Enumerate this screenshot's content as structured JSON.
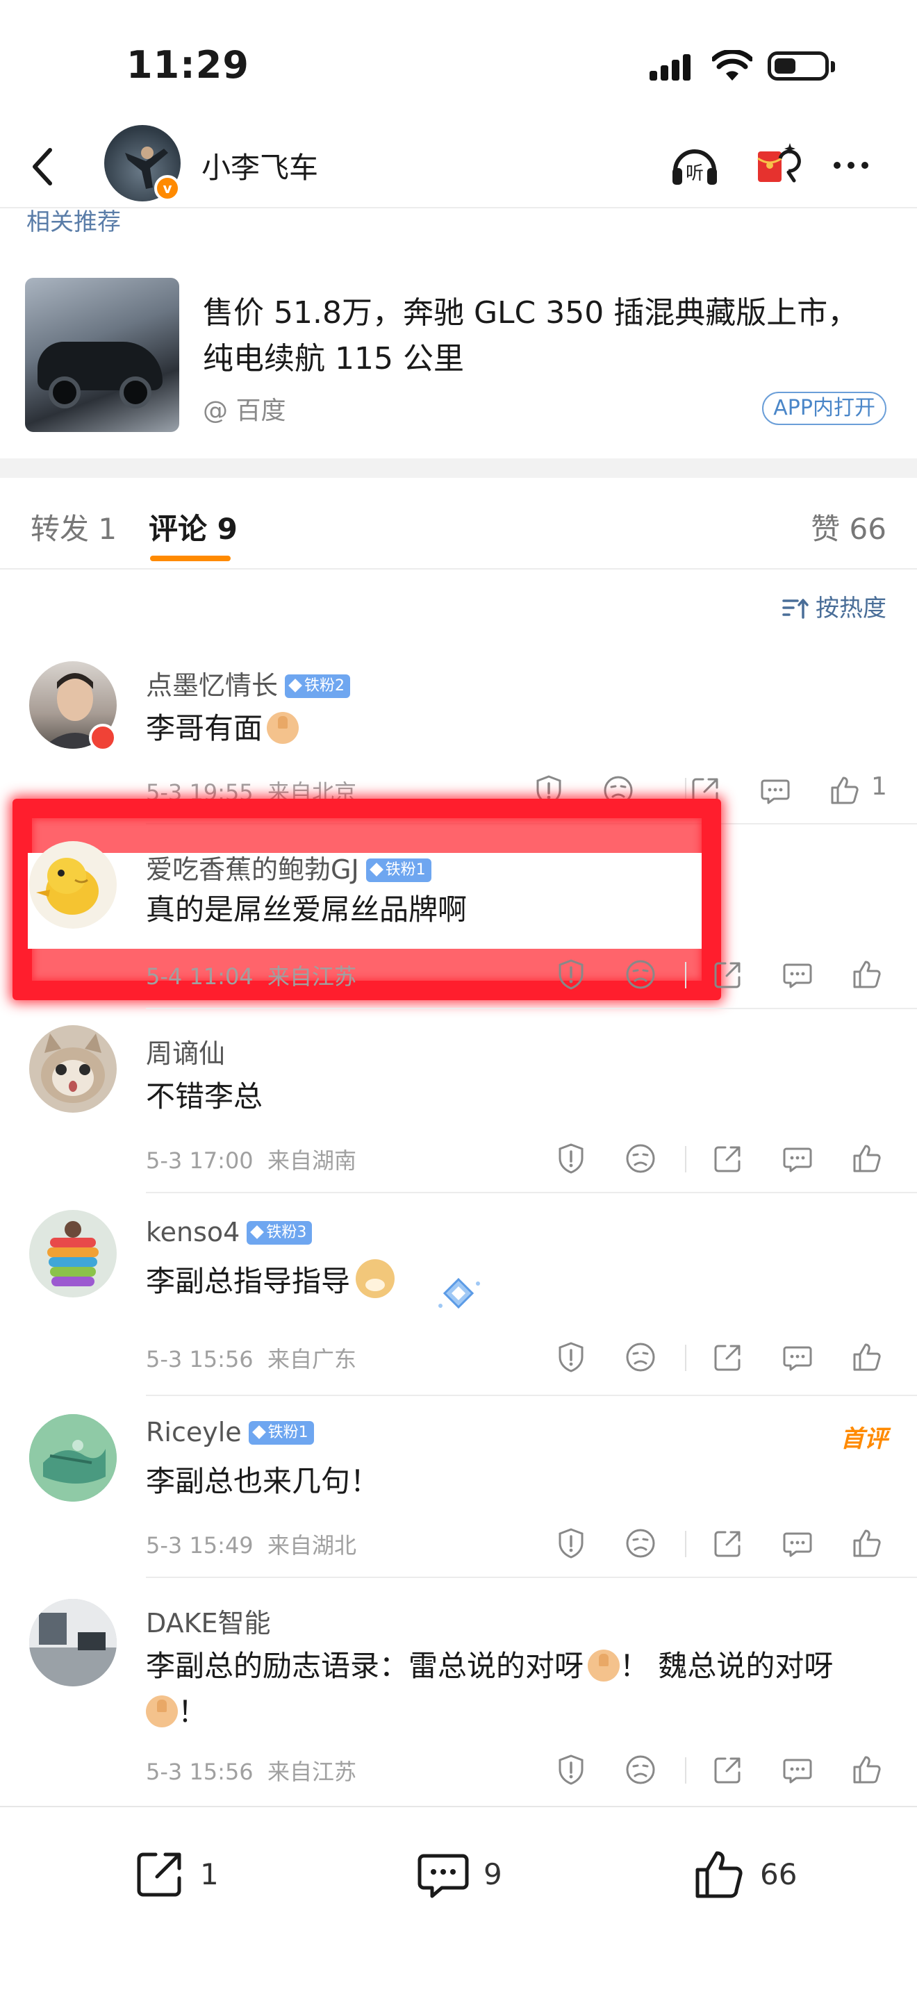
{
  "status_bar": {
    "time": "11:29"
  },
  "nav": {
    "username": "小李飞车",
    "verified_badge": "v",
    "icons": [
      "back-icon",
      "listen-icon",
      "red-envelope-icon",
      "more-icon"
    ],
    "listen_label": "听"
  },
  "related": {
    "label": "相关推荐"
  },
  "news": {
    "title": "售价 51.8万，奔驰 GLC 350 插混典藏版上市，纯电续航 115 公里",
    "source": "@ 百度",
    "open_button": "APP内打开"
  },
  "tabs": {
    "repost": "转发 1",
    "comments": "评论 9",
    "likes": "赞 66"
  },
  "sort": {
    "label": "按热度"
  },
  "comments": [
    {
      "name": "点墨忆情长",
      "badge": "铁粉2",
      "text": "李哥有面",
      "emoji": "thumbs-up",
      "time": "5-3 19:55",
      "location": "来自北京",
      "likes": "1"
    },
    {
      "name": "爱吃香蕉的鲍勃GJ",
      "badge": "铁粉1",
      "text": "真的是屌丝爱屌丝品牌啊",
      "time": "5-4 11:04",
      "location": "来自江苏",
      "likes": ""
    },
    {
      "name": "周谪仙",
      "badge": "",
      "text": "不错李总",
      "time": "5-3 17:00",
      "location": "来自湖南",
      "likes": ""
    },
    {
      "name": "kenso4",
      "badge": "铁粉3",
      "text": "李副总指导指导",
      "emoji": "doge",
      "time": "5-3 15:56",
      "location": "来自广东",
      "likes": ""
    },
    {
      "name": "Riceyle",
      "badge": "铁粉1",
      "text": "李副总也来几句！",
      "time": "5-3 15:49",
      "location": "来自湖北",
      "likes": "",
      "tag": "首评"
    },
    {
      "name": "DAKE智能",
      "badge": "",
      "text_part1": "李副总的励志语录：雷总说的对呀",
      "text_part2": "！ 魏总说的对呀",
      "text_part3": "！",
      "time": "5-3 15:56",
      "location": "来自江苏",
      "likes": ""
    }
  ],
  "bottom_bar": {
    "repost_count": "1",
    "comment_count": "9",
    "like_count": "66"
  },
  "colors": {
    "accent": "#ff8a00",
    "link": "#5a7da8",
    "fan_badge": "#6ea6f0",
    "highlight_box": "#ff1e2d"
  }
}
